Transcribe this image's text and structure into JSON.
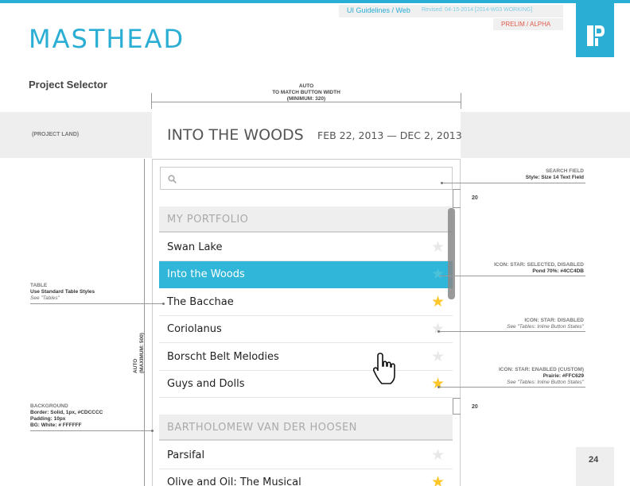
{
  "header": {
    "title": "MASTHEAD",
    "guidelines": "UI Guidelines / Web",
    "revised": "Revised: 04-15-2014 [2014-W03 WORKING]",
    "status": "PRELIM / ALPHA"
  },
  "section_label": "Project Selector",
  "band_label": "(PROJECT LAND)",
  "auto_width_note": {
    "line1": "AUTO",
    "line2": "TO MATCH BUTTON WIDTH",
    "line3": "(MINIMUM: 320)"
  },
  "auto_height_note": {
    "line1": "AUTO",
    "line2": "(MAXIMUM: 500)"
  },
  "project": {
    "name": "INTO THE WOODS",
    "dates": "FEB 22, 2013 — DEC 2, 2013"
  },
  "search": {
    "placeholder": ""
  },
  "groups": [
    {
      "name": "MY PORTFOLIO",
      "items": [
        {
          "label": "Swan Lake",
          "star": "disabled"
        },
        {
          "label": "Into the Woods",
          "star": "selected-disabled",
          "selected": true
        },
        {
          "label": "The Bacchae",
          "star": "enabled"
        },
        {
          "label": "Coriolanus",
          "star": "disabled"
        },
        {
          "label": "Borscht Belt Melodies",
          "star": "disabled"
        },
        {
          "label": "Guys and Dolls",
          "star": "enabled"
        }
      ]
    },
    {
      "name": "BARTHOLOMEW VAN DER HOOSEN",
      "items": [
        {
          "label": "Parsifal",
          "star": "disabled"
        },
        {
          "label": "Olive and Oil: The Musical",
          "star": "enabled"
        }
      ]
    }
  ],
  "callouts": {
    "search_field": {
      "title": "SEARCH FIELD",
      "body": "Style: Size 14 Text Field"
    },
    "star_selected": {
      "title": "ICON: STAR: SELECTED, DISABLED",
      "body": "Pond 70%: #4CC4DB"
    },
    "table": {
      "title": "TABLE",
      "body": "Use Standard Table Styles",
      "note": "See \"Tables\""
    },
    "star_disabled": {
      "title": "ICON: STAR: DISABLED",
      "note": "See \"Tables: Inline Button States\""
    },
    "star_enabled": {
      "title": "ICON: STAR: ENABLED (CUSTOM)",
      "body": "Prairie: #FFC629",
      "note": "See \"Tables: Inline Button States\""
    },
    "background": {
      "title": "BACKGROUND",
      "line1": "Border: Solid, 1px, #CDCCCC",
      "line2": "Padding: 10px",
      "line3": "BG: White: # FFFFFF"
    }
  },
  "spacing": {
    "top": "20",
    "bottom": "20"
  },
  "page_number": "24",
  "colors": {
    "accent": "#2aaed4",
    "selected_row": "#30b6d9",
    "star_enabled": "#FFC629",
    "star_selected_disabled": "#4CC4DB",
    "star_disabled": "#e8e8e8",
    "border": "#CDCCCC"
  }
}
